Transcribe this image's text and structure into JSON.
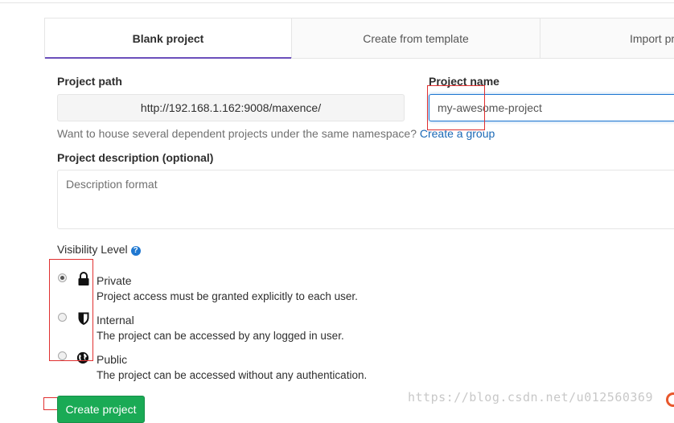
{
  "tabs": [
    {
      "label": "Blank project",
      "active": true
    },
    {
      "label": "Create from template",
      "active": false
    },
    {
      "label": "Import pr",
      "active": false
    }
  ],
  "project_path": {
    "label": "Project path",
    "value": "http://192.168.1.162:9008/maxence/"
  },
  "project_name": {
    "label": "Project name",
    "value": "my-awesome-project"
  },
  "namespace_hint": {
    "text": "Want to house several dependent projects under the same namespace?",
    "link": "Create a group"
  },
  "description": {
    "label": "Project description (optional)",
    "placeholder": "Description format"
  },
  "visibility": {
    "label": "Visibility Level",
    "help_icon": "question-circle-icon",
    "options": [
      {
        "title": "Private",
        "desc": "Project access must be granted explicitly to each user.",
        "icon": "lock-icon",
        "checked": true
      },
      {
        "title": "Internal",
        "desc": "The project can be accessed by any logged in user.",
        "icon": "shield-icon",
        "checked": false
      },
      {
        "title": "Public",
        "desc": "The project can be accessed without any authentication.",
        "icon": "globe-icon",
        "checked": false
      }
    ]
  },
  "create_button": "Create project",
  "watermark": "https://blog.csdn.net/u012560369",
  "colors": {
    "accent": "#6b4fbb",
    "link": "#1b69b6",
    "primary_button": "#1aaa55",
    "annotation": "#e03030"
  }
}
